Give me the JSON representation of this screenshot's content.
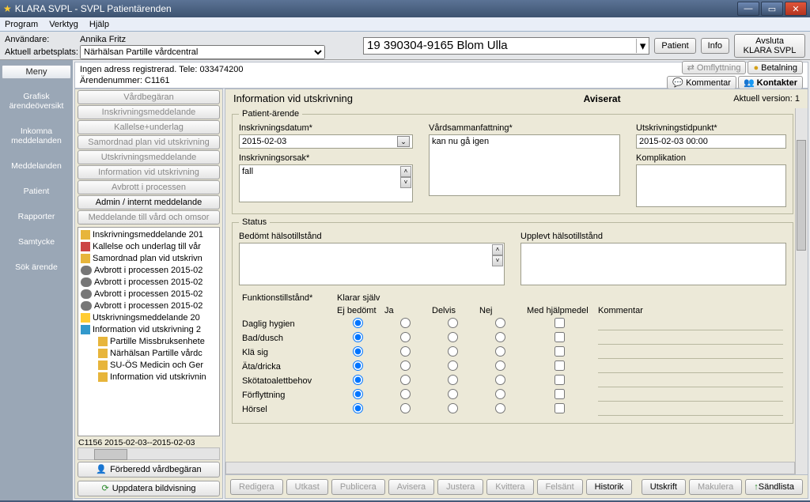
{
  "window": {
    "title": "KLARA SVPL - SVPL Patientärenden"
  },
  "menu": {
    "program": "Program",
    "verktyg": "Verktyg",
    "hjalp": "Hjälp"
  },
  "toolbar": {
    "user_label": "Användare:",
    "user_value": "Annika Fritz",
    "workplace_label": "Aktuell arbetsplats:",
    "workplace_value": "Närhälsan Partille vårdcentral",
    "patient_combo": "19 390304-9165 Blom Ulla",
    "btn_patient": "Patient",
    "btn_info": "Info",
    "btn_quit1": "Avsluta",
    "btn_quit2": "KLARA SVPL"
  },
  "sidebar": {
    "meny": "Meny",
    "items": [
      "Grafisk ärendeöversikt",
      "Inkomna meddelanden",
      "Meddelanden",
      "Patient",
      "Rapporter",
      "Samtycke",
      "Sök ärende"
    ]
  },
  "topstrip": {
    "line1": "Ingen adress registrerad.  Tele: 033474200",
    "line2": "Ärendenummer: C1161",
    "btn_omflytt": "Omflyttning",
    "btn_betal": "Betalning",
    "btn_kommentar": "Kommentar",
    "btn_kontakter": "Kontakter"
  },
  "actions": {
    "buttons": [
      "Vårdbegäran",
      "Inskrivningsmeddelande",
      "Kallelse+underlag",
      "Samordnad plan vid utskrivning",
      "Utskrivningsmeddelande",
      "Information vid utskrivning",
      "Avbrott i processen",
      "Admin / internt meddelande",
      "Meddelande till vård och omsor"
    ],
    "active_index": 7,
    "tree": [
      {
        "icon": "doc",
        "text": "Inskrivningsmeddelande 201",
        "ind": 0
      },
      {
        "icon": "cal",
        "text": "Kallelse och underlag till vår",
        "ind": 0
      },
      {
        "icon": "doc",
        "text": "Samordnad plan vid utskrivn",
        "ind": 0
      },
      {
        "icon": "link",
        "text": "Avbrott i processen 2015-02",
        "ind": 0
      },
      {
        "icon": "link",
        "text": "Avbrott i processen 2015-02",
        "ind": 0
      },
      {
        "icon": "link",
        "text": "Avbrott i processen 2015-02",
        "ind": 0
      },
      {
        "icon": "link",
        "text": "Avbrott i processen 2015-02",
        "ind": 0
      },
      {
        "icon": "star",
        "text": "Utskrivningsmeddelande 20",
        "ind": 0
      },
      {
        "icon": "info",
        "text": "Information vid utskrivning 2",
        "ind": 0
      },
      {
        "icon": "",
        "text": "Partille Missbruksenhete",
        "ind": 1
      },
      {
        "icon": "",
        "text": "Närhälsan Partille vårdc",
        "ind": 1
      },
      {
        "icon": "",
        "text": "SU-ÖS Medicin och Ger",
        "ind": 1
      },
      {
        "icon": "",
        "text": "Information vid utskrivnin",
        "ind": 1
      }
    ],
    "tree_footer": "C1156 2015-02-03--2015-02-03",
    "btn_prep": "Förberedd vårdbegäran",
    "btn_upd": "Uppdatera bildvisning"
  },
  "form": {
    "title": "Information vid utskrivning",
    "aviserat": "Aviserat",
    "version": "Aktuell version: 1",
    "fs_patient": "Patient-ärende",
    "lbl_inskr_datum": "Inskrivningsdatum*",
    "val_inskr_datum": "2015-02-03",
    "lbl_inskr_orsak": "Inskrivningsorsak*",
    "val_inskr_orsak": "fall",
    "lbl_vss": "Vårdsammanfattning*",
    "val_vss": "kan nu gå igen",
    "lbl_utskrivtid": "Utskrivningstidpunkt*",
    "val_utskrivtid": "2015-02-03 00:00",
    "lbl_kompl": "Komplikation",
    "fs_status": "Status",
    "lbl_bedomt": "Bedömt hälsotillstånd",
    "lbl_upplevt": "Upplevt hälsotillstånd",
    "lbl_funk": "Funktionstillstånd*",
    "lbl_klarar": "Klarar själv",
    "col_ej": "Ej bedömt",
    "col_ja": "Ja",
    "col_delvis": "Delvis",
    "col_nej": "Nej",
    "col_hjalp": "Med hjälpmedel",
    "col_komm": "Kommentar",
    "rows": [
      "Daglig hygien",
      "Bad/dusch",
      "Klä sig",
      "Äta/dricka",
      "Skötatoalettbehov",
      "Förflyttning",
      "Hörsel"
    ]
  },
  "bottom": {
    "buttons": [
      "Redigera",
      "Utkast",
      "Publicera",
      "Avisera",
      "Justera",
      "Kvittera",
      "Felsänt",
      "Historik"
    ],
    "enabled": [
      false,
      false,
      false,
      false,
      false,
      false,
      false,
      true
    ],
    "btn_utskrift": "Utskrift",
    "btn_makulera": "Makulera",
    "btn_sandlista": "Sändlista"
  }
}
